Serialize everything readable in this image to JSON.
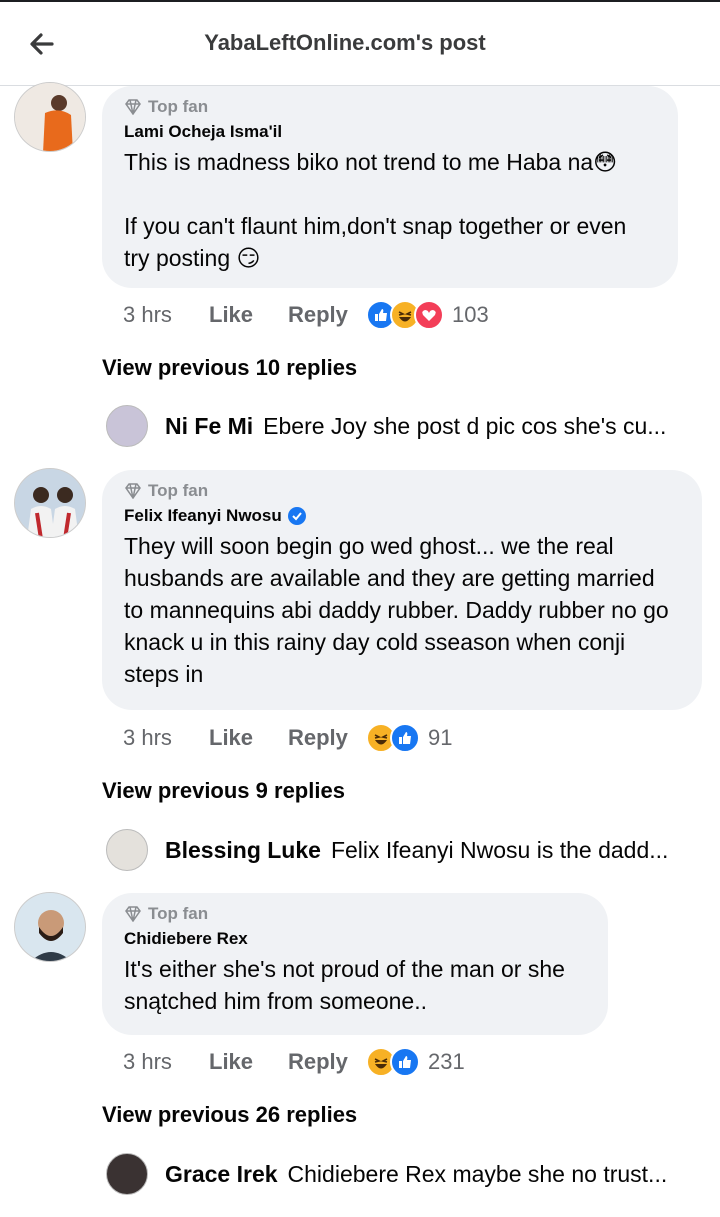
{
  "header": {
    "title": "YabaLeftOnline.com's post",
    "back_icon": "arrow-left-icon"
  },
  "comments": [
    {
      "badge": "Top fan",
      "author": "Lami Ocheja Isma'il",
      "text": "This is madness biko not trend to me Haba na😳\n\nIf you can't flaunt him,don't snap together or even try posting 😏",
      "time": "3 hrs",
      "like": "Like",
      "reply": "Reply",
      "reactions": [
        "like",
        "haha",
        "love"
      ],
      "count": "103",
      "view_previous": "View previous 10 replies",
      "latest_reply": {
        "name": "Ni Fe Mi",
        "text": "Ebere Joy she post d pic cos she's cu..."
      }
    },
    {
      "badge": "Top fan",
      "author": "Felix Ifeanyi Nwosu",
      "text": "They will soon begin go wed ghost... we the real husbands are available and they are getting married to mannequins abi daddy rubber. Daddy rubber no go knack u in this rainy day cold sseason when conji steps in",
      "time": "3 hrs",
      "like": "Like",
      "reply": "Reply",
      "reactions": [
        "haha",
        "like"
      ],
      "count": "91",
      "view_previous": "View previous 9 replies",
      "latest_reply": {
        "name": "Blessing Luke",
        "text": "Felix Ifeanyi Nwosu is the dadd..."
      }
    },
    {
      "badge": "Top fan",
      "author": "Chidiebere Rex",
      "text": "It's either she's not proud of the man or she snątched him from someone..",
      "time": "3 hrs",
      "like": "Like",
      "reply": "Reply",
      "reactions": [
        "haha",
        "like"
      ],
      "count": "231",
      "view_previous": "View previous 26 replies",
      "latest_reply": {
        "name": "Grace Irek",
        "text": "Chidiebere Rex maybe she no trust..."
      }
    }
  ],
  "colors": {
    "bubble": "#f0f2f5",
    "meta": "#65676b",
    "like_blue": "#1877f2",
    "love_red": "#f33e58",
    "haha_yellow": "#f7b125"
  }
}
